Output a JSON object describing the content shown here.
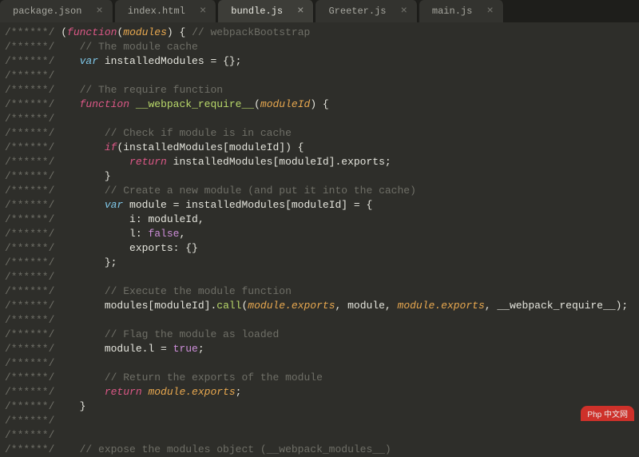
{
  "tabs": [
    {
      "label": "package.json",
      "active": false
    },
    {
      "label": "index.html",
      "active": false
    },
    {
      "label": "bundle.js",
      "active": true
    },
    {
      "label": "Greeter.js",
      "active": false
    },
    {
      "label": "main.js",
      "active": false
    }
  ],
  "close_glyph": "×",
  "watermark": "Php 中文网",
  "code_lines": [
    {
      "gutter": "/******/ ",
      "tokens": [
        {
          "c": "pun",
          "t": "("
        },
        {
          "c": "kw",
          "t": "function"
        },
        {
          "c": "pun",
          "t": "("
        },
        {
          "c": "prm",
          "t": "modules"
        },
        {
          "c": "pun",
          "t": ") { "
        },
        {
          "c": "cmt",
          "t": "// webpackBootstrap"
        }
      ]
    },
    {
      "gutter": "/******/    ",
      "tokens": [
        {
          "c": "cmt",
          "t": "// The module cache"
        }
      ]
    },
    {
      "gutter": "/******/    ",
      "tokens": [
        {
          "c": "kwv",
          "t": "var"
        },
        {
          "c": "def",
          "t": " installedModules "
        },
        {
          "c": "pun",
          "t": "= {};"
        }
      ]
    },
    {
      "gutter": "/******/",
      "tokens": []
    },
    {
      "gutter": "/******/    ",
      "tokens": [
        {
          "c": "cmt",
          "t": "// The require function"
        }
      ]
    },
    {
      "gutter": "/******/    ",
      "tokens": [
        {
          "c": "kw",
          "t": "function"
        },
        {
          "c": "def",
          "t": " "
        },
        {
          "c": "fn",
          "t": "__webpack_require__"
        },
        {
          "c": "pun",
          "t": "("
        },
        {
          "c": "prm",
          "t": "moduleId"
        },
        {
          "c": "pun",
          "t": ") {"
        }
      ]
    },
    {
      "gutter": "/******/",
      "tokens": []
    },
    {
      "gutter": "/******/        ",
      "tokens": [
        {
          "c": "cmt",
          "t": "// Check if module is in cache"
        }
      ]
    },
    {
      "gutter": "/******/        ",
      "tokens": [
        {
          "c": "kw",
          "t": "if"
        },
        {
          "c": "pun",
          "t": "(installedModules[moduleId]) {"
        }
      ]
    },
    {
      "gutter": "/******/            ",
      "tokens": [
        {
          "c": "ret",
          "t": "return"
        },
        {
          "c": "def",
          "t": " installedModules[moduleId].exports;"
        }
      ]
    },
    {
      "gutter": "/******/        ",
      "tokens": [
        {
          "c": "pun",
          "t": "}"
        }
      ]
    },
    {
      "gutter": "/******/        ",
      "tokens": [
        {
          "c": "cmt",
          "t": "// Create a new module (and put it into the cache)"
        }
      ]
    },
    {
      "gutter": "/******/        ",
      "tokens": [
        {
          "c": "kwv",
          "t": "var"
        },
        {
          "c": "def",
          "t": " module "
        },
        {
          "c": "pun",
          "t": "= installedModules[moduleId] = {"
        }
      ]
    },
    {
      "gutter": "/******/            ",
      "tokens": [
        {
          "c": "def",
          "t": "i"
        },
        {
          "c": "pun",
          "t": ": moduleId,"
        }
      ]
    },
    {
      "gutter": "/******/            ",
      "tokens": [
        {
          "c": "def",
          "t": "l"
        },
        {
          "c": "pun",
          "t": ": "
        },
        {
          "c": "num",
          "t": "false"
        },
        {
          "c": "pun",
          "t": ","
        }
      ]
    },
    {
      "gutter": "/******/            ",
      "tokens": [
        {
          "c": "def",
          "t": "exports"
        },
        {
          "c": "pun",
          "t": ": {}"
        }
      ]
    },
    {
      "gutter": "/******/        ",
      "tokens": [
        {
          "c": "pun",
          "t": "};"
        }
      ]
    },
    {
      "gutter": "/******/",
      "tokens": []
    },
    {
      "gutter": "/******/        ",
      "tokens": [
        {
          "c": "cmt",
          "t": "// Execute the module function"
        }
      ]
    },
    {
      "gutter": "/******/        ",
      "tokens": [
        {
          "c": "def",
          "t": "modules[moduleId]."
        },
        {
          "c": "fn",
          "t": "call"
        },
        {
          "c": "pun",
          "t": "("
        },
        {
          "c": "prmi",
          "t": "module.exports"
        },
        {
          "c": "pun",
          "t": ", module, "
        },
        {
          "c": "prmi",
          "t": "module.exports"
        },
        {
          "c": "pun",
          "t": ", __webpack_require__);"
        }
      ]
    },
    {
      "gutter": "/******/",
      "tokens": []
    },
    {
      "gutter": "/******/        ",
      "tokens": [
        {
          "c": "cmt",
          "t": "// Flag the module as loaded"
        }
      ]
    },
    {
      "gutter": "/******/        ",
      "tokens": [
        {
          "c": "def",
          "t": "module.l "
        },
        {
          "c": "pun",
          "t": "= "
        },
        {
          "c": "num",
          "t": "true"
        },
        {
          "c": "pun",
          "t": ";"
        }
      ]
    },
    {
      "gutter": "/******/",
      "tokens": []
    },
    {
      "gutter": "/******/        ",
      "tokens": [
        {
          "c": "cmt",
          "t": "// Return the exports of the module"
        }
      ]
    },
    {
      "gutter": "/******/        ",
      "tokens": [
        {
          "c": "ret",
          "t": "return"
        },
        {
          "c": "def",
          "t": " "
        },
        {
          "c": "prmi",
          "t": "module.exports"
        },
        {
          "c": "pun",
          "t": ";"
        }
      ]
    },
    {
      "gutter": "/******/    ",
      "tokens": [
        {
          "c": "pun",
          "t": "}"
        }
      ]
    },
    {
      "gutter": "/******/",
      "tokens": []
    },
    {
      "gutter": "/******/",
      "tokens": []
    },
    {
      "gutter": "/******/    ",
      "tokens": [
        {
          "c": "cmt",
          "t": "// expose the modules object (__webpack_modules__)"
        }
      ]
    }
  ]
}
